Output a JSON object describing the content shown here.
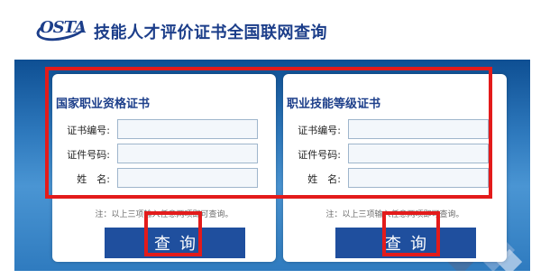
{
  "header": {
    "logo_text": "OSTA",
    "title": "技能人才评价证书全国联网查询"
  },
  "colors": {
    "brand_blue": "#1c3e8a",
    "button_blue": "#1f4f9e",
    "annotation_red": "#e31b1b",
    "panel_background": "#2e79bd"
  },
  "cards": [
    {
      "title": "国家职业资格证书",
      "fields": [
        {
          "label": "证书编号:",
          "value": "",
          "placeholder": ""
        },
        {
          "label": "证件号码:",
          "value": "",
          "placeholder": ""
        },
        {
          "label": "姓　名:",
          "value": "",
          "placeholder": ""
        }
      ],
      "note": "注：以上三项输入任意两项即可查询。",
      "button": "查询"
    },
    {
      "title": "职业技能等级证书",
      "fields": [
        {
          "label": "证书编号:",
          "value": "",
          "placeholder": ""
        },
        {
          "label": "证件号码:",
          "value": "",
          "placeholder": ""
        },
        {
          "label": "姓　名:",
          "value": "",
          "placeholder": ""
        }
      ],
      "note": "注：以上三项输入任意两项即可查询。",
      "button": "查询"
    }
  ]
}
